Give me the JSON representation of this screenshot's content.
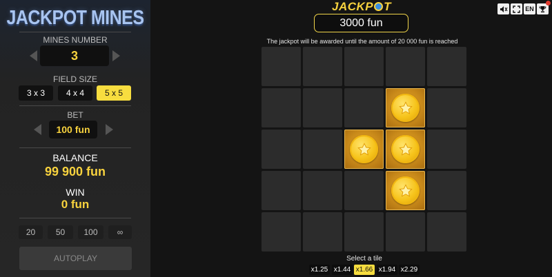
{
  "game": {
    "title": "JACKPOT MINES"
  },
  "left": {
    "mines_label": "MINES NUMBER",
    "mines_value": "3",
    "field_size_label": "FIELD SIZE",
    "field_sizes": [
      "3 x 3",
      "4 x 4",
      "5 x 5"
    ],
    "field_size_selected": "5 x 5",
    "bet_label": "BET",
    "bet_value": "100 fun",
    "balance_label": "BALANCE",
    "balance_value": "99 900 fun",
    "win_label": "WIN",
    "win_value": "0 fun",
    "quick_bets": [
      "20",
      "50",
      "100",
      "∞"
    ],
    "autoplay_label": "AUTOPLAY"
  },
  "controls": {
    "sound": "sound-icon",
    "fullscreen": "fullscreen-icon",
    "language": "EN",
    "trophy": "trophy-icon"
  },
  "jackpot": {
    "title_pre": "JACKP",
    "title_post": "T",
    "amount": "3000 fun",
    "note": "The jackpot will be awarded until the amount of 20 000 fun is reached"
  },
  "grid": {
    "rows": 5,
    "cols": 5,
    "revealed": [
      [
        1,
        3
      ],
      [
        2,
        2
      ],
      [
        2,
        3
      ],
      [
        3,
        3
      ]
    ]
  },
  "bottom": {
    "prompt": "Select a tile",
    "multipliers": [
      "x1.25",
      "x1.44",
      "x1.66",
      "x1.94",
      "x2.29"
    ],
    "active_multiplier": "x1.66"
  },
  "colors": {
    "accent": "#f7dd3f",
    "tile": "#2c2c2c",
    "revealed_tile": "#c98a1a"
  }
}
